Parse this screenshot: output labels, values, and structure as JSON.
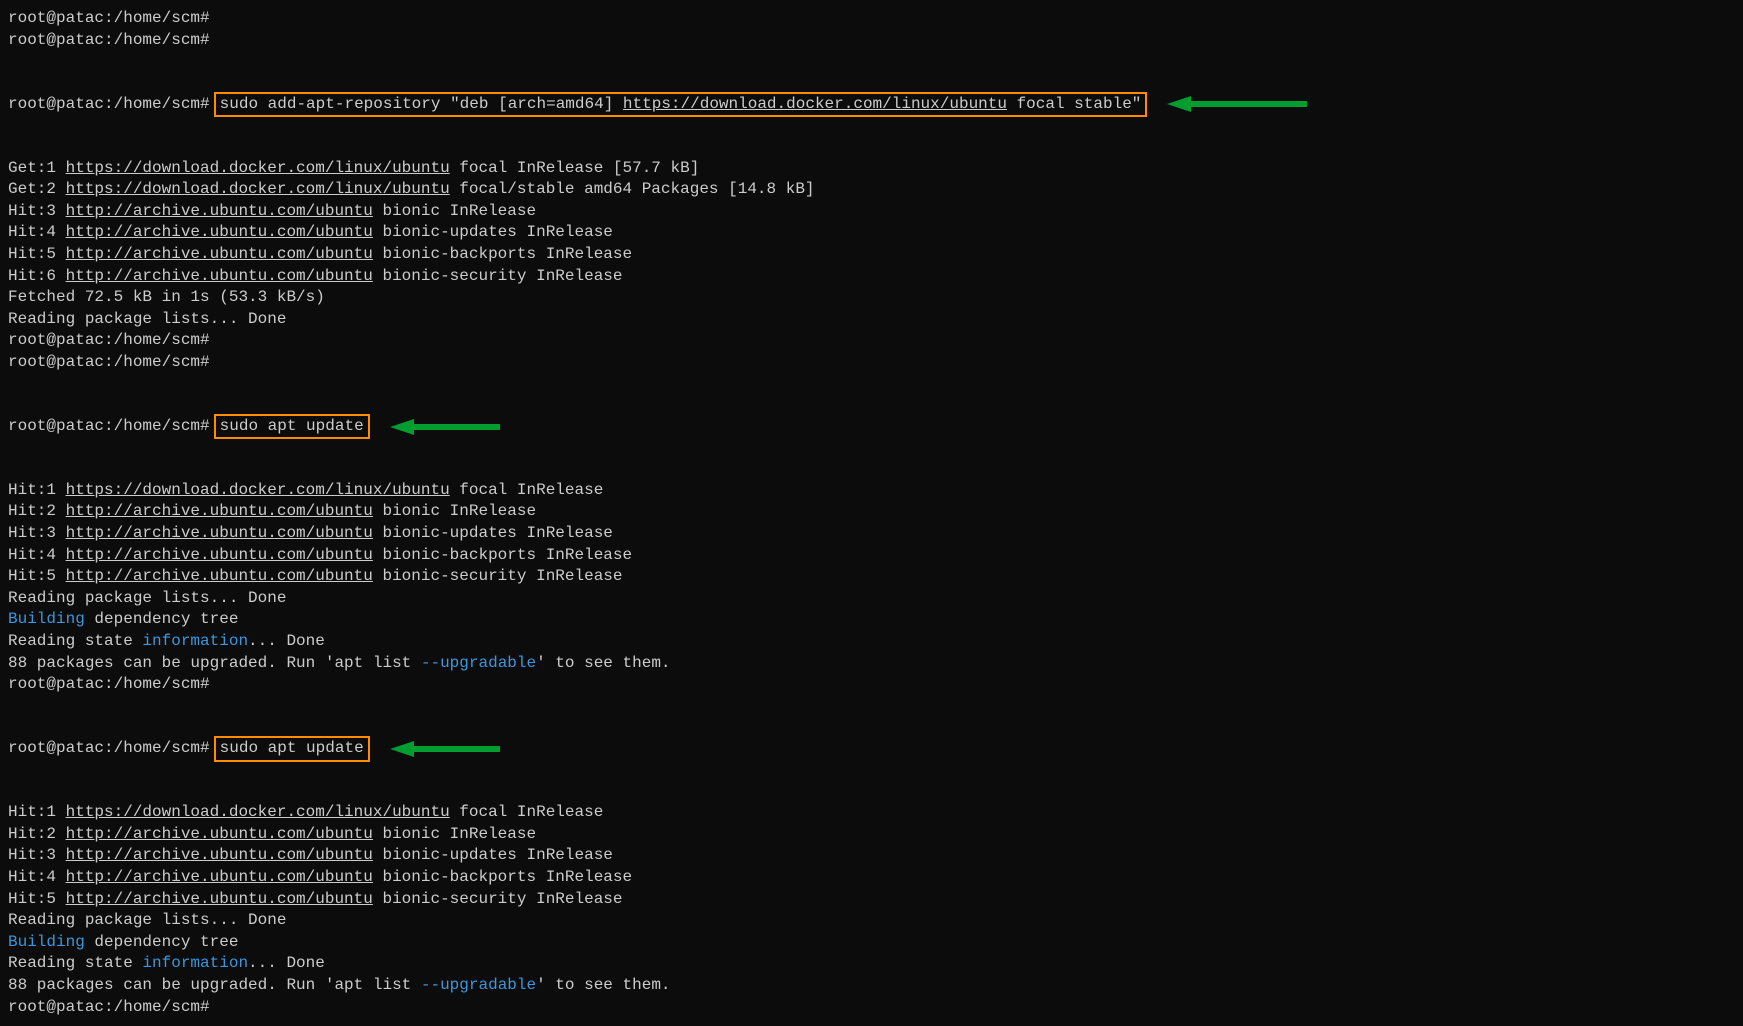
{
  "prompt": "root@patac:/home/scm#",
  "block1": {
    "empty1": "",
    "empty2": "",
    "cmd": "sudo add-apt-repository \"deb [arch=amd64] ",
    "cmd_url": "https://download.docker.com/linux/ubuntu",
    "cmd_tail": " focal stable\"",
    "l1a": "Get:1 ",
    "l1u": "https://download.docker.com/linux/ubuntu",
    "l1b": " focal InRelease [57.7 kB]",
    "l2a": "Get:2 ",
    "l2u": "https://download.docker.com/linux/ubuntu",
    "l2b": " focal/stable amd64 Packages [14.8 kB]",
    "l3a": "Hit:3 ",
    "l3u": "http://archive.ubuntu.com/ubuntu",
    "l3b": " bionic InRelease",
    "l4a": "Hit:4 ",
    "l4u": "http://archive.ubuntu.com/ubuntu",
    "l4b": " bionic-updates InRelease",
    "l5a": "Hit:5 ",
    "l5u": "http://archive.ubuntu.com/ubuntu",
    "l5b": " bionic-backports InRelease",
    "l6a": "Hit:6 ",
    "l6u": "http://archive.ubuntu.com/ubuntu",
    "l6b": " bionic-security InRelease",
    "l7": "Fetched 72.5 kB in 1s (53.3 kB/s)",
    "l8": "Reading package lists... Done"
  },
  "block2": {
    "empty1": "",
    "cmd": "sudo apt update",
    "l1a": "Hit:1 ",
    "l1u": "https://download.docker.com/linux/ubuntu",
    "l1b": " focal InRelease",
    "l2a": "Hit:2 ",
    "l2u": "http://archive.ubuntu.com/ubuntu",
    "l2b": " bionic InRelease",
    "l3a": "Hit:3 ",
    "l3u": "http://archive.ubuntu.com/ubuntu",
    "l3b": " bionic-updates InRelease",
    "l4a": "Hit:4 ",
    "l4u": "http://archive.ubuntu.com/ubuntu",
    "l4b": " bionic-backports InRelease",
    "l5a": "Hit:5 ",
    "l5u": "http://archive.ubuntu.com/ubuntu",
    "l5b": " bionic-security InRelease",
    "l6": "Reading package lists... Done",
    "l7a": "Building",
    "l7b": " dependency tree",
    "l8a": "Reading state ",
    "l8b": "information",
    "l8c": "... Done",
    "l9a": "88 packages can be upgraded. Run 'apt list ",
    "l9b": "--upgradable",
    "l9c": "' to see them."
  },
  "block3": {
    "empty1": "",
    "cmd": "sudo apt update",
    "l1a": "Hit:1 ",
    "l1u": "https://download.docker.com/linux/ubuntu",
    "l1b": " focal InRelease",
    "l2a": "Hit:2 ",
    "l2u": "http://archive.ubuntu.com/ubuntu",
    "l2b": " bionic InRelease",
    "l3a": "Hit:3 ",
    "l3u": "http://archive.ubuntu.com/ubuntu",
    "l3b": " bionic-updates InRelease",
    "l4a": "Hit:4 ",
    "l4u": "http://archive.ubuntu.com/ubuntu",
    "l4b": " bionic-backports InRelease",
    "l5a": "Hit:5 ",
    "l5u": "http://archive.ubuntu.com/ubuntu",
    "l5b": " bionic-security InRelease",
    "l6": "Reading package lists... Done",
    "l7a": "Building",
    "l7b": " dependency tree",
    "l8a": "Reading state ",
    "l8b": "information",
    "l8c": "... Done",
    "l9a": "88 packages can be upgraded. Run 'apt list ",
    "l9b": "--upgradable",
    "l9c": "' to see them."
  },
  "final_empty": ""
}
